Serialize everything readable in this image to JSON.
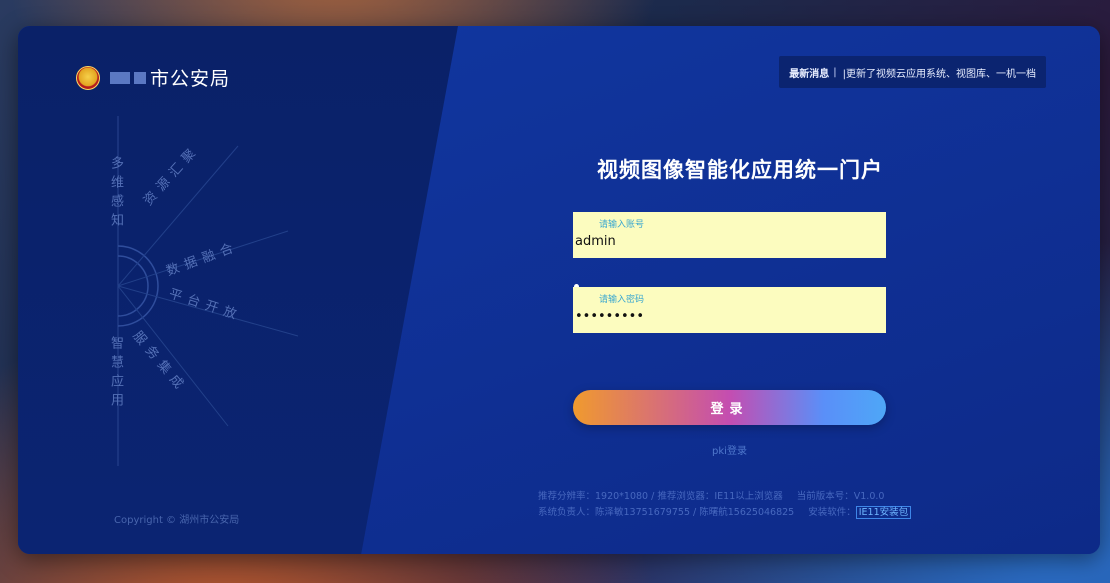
{
  "header": {
    "org_suffix": "市公安局",
    "news_label": "最新消息",
    "news_sep": "|",
    "news_text": "|更新了视频云应用系统、视图库、一机一档"
  },
  "deco_words": [
    "多维感知",
    "资源汇聚",
    "数据融合",
    "平台开放",
    "服务集成",
    "智慧应用"
  ],
  "copyright": "Copyright © 湖州市公安局",
  "login": {
    "title": "视频图像智能化应用统一门户",
    "username_placeholder": "请输入账号",
    "username_value": "admin",
    "password_placeholder": "请输入密码",
    "password_value": "•••••••••",
    "button_label": "登录",
    "pki_link": "pki登录"
  },
  "footer": {
    "resolution": "推荐分辨率：1920*1080 / 推荐浏览器：IE11以上浏览器",
    "version": "当前版本号：V1.0.0",
    "contact": "系统负责人：陈泽敏13751679755 / 陈曙航15625046825",
    "software_label": "安装软件：",
    "software_link": "IE11安装包"
  },
  "colors": {
    "card_bg": "#0f2b87",
    "input_bg": "#fcfcbf",
    "button_gradient_start": "#f09a2e",
    "button_gradient_end": "#4ea7f7"
  }
}
